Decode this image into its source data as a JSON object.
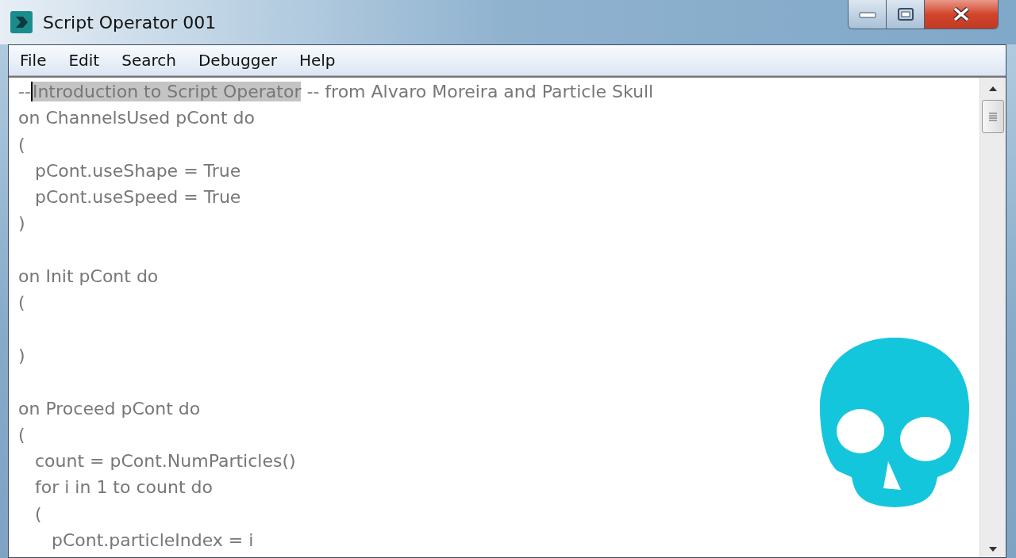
{
  "window": {
    "title": "Script Operator 001"
  },
  "menu": [
    "File",
    "Edit",
    "Search",
    "Debugger",
    "Help"
  ],
  "editor": {
    "lines": [
      {
        "kind": "split",
        "parts": [
          {
            "text": "--",
            "selected": false
          },
          {
            "text": "Introduction to Script Operator",
            "selected": true
          },
          {
            "text": " -- from Alvaro Moreira and Particle Skull",
            "selected": false
          }
        ]
      },
      {
        "kind": "plain",
        "text": "on ChannelsUsed pCont do"
      },
      {
        "kind": "plain",
        "text": "("
      },
      {
        "kind": "plain",
        "text": "   pCont.useShape = True"
      },
      {
        "kind": "plain",
        "text": "   pCont.useSpeed = True"
      },
      {
        "kind": "plain",
        "text": ")"
      },
      {
        "kind": "blank"
      },
      {
        "kind": "plain",
        "text": "on Init pCont do"
      },
      {
        "kind": "plain",
        "text": "("
      },
      {
        "kind": "blank"
      },
      {
        "kind": "plain",
        "text": ")"
      },
      {
        "kind": "blank"
      },
      {
        "kind": "plain",
        "text": "on Proceed pCont do"
      },
      {
        "kind": "plain",
        "text": "("
      },
      {
        "kind": "plain",
        "text": "   count = pCont.NumParticles()"
      },
      {
        "kind": "plain",
        "text": "   for i in 1 to count do"
      },
      {
        "kind": "plain",
        "text": "   ("
      },
      {
        "kind": "plain",
        "text": "      pCont.particleIndex = i"
      }
    ]
  }
}
